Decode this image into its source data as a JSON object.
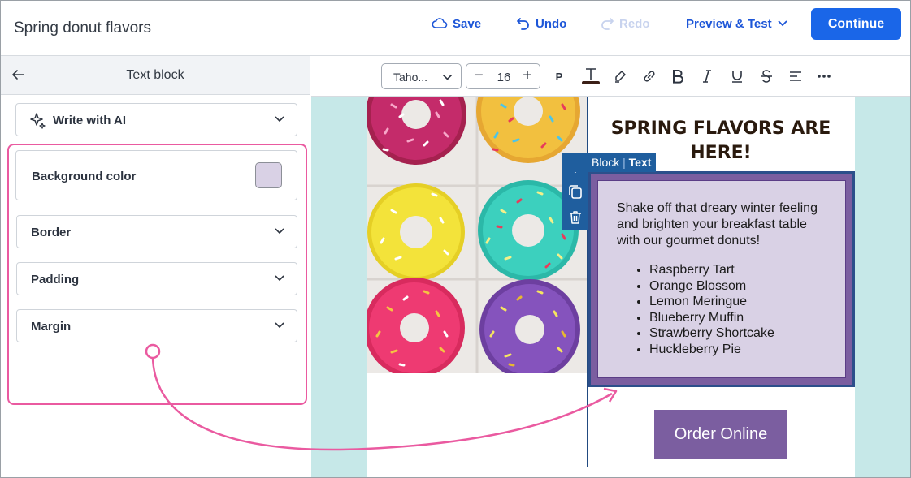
{
  "header": {
    "title": "Spring donut flavors",
    "save_label": "Save",
    "undo_label": "Undo",
    "redo_label": "Redo",
    "preview_label": "Preview & Test",
    "continue_label": "Continue"
  },
  "left_panel": {
    "title": "Text block",
    "ai_label": "Write with AI",
    "background_label": "Background color",
    "background_value": "#d9d1e5",
    "sections": [
      "Border",
      "Padding",
      "Margin"
    ]
  },
  "toolbar": {
    "font": "Taho...",
    "font_size": "16",
    "paragraph": "P"
  },
  "email": {
    "headline": "SPRING FLAVORS ARE HERE!",
    "block_tag_block": "Block",
    "block_tag_sep": "|",
    "block_tag_type": "Text",
    "paragraph": "Shake off that dreary winter feeling and brighten your breakfast table with our gourmet donuts!",
    "flavors": [
      "Raspberry Tart",
      "Orange Blossom",
      "Lemon Meringue",
      "Blueberry Muffin",
      "Strawberry Shortcake",
      "Huckleberry Pie"
    ],
    "button_label": "Order Online"
  },
  "colors": {
    "accent": "#1a66e8",
    "highlight": "#ea5aa0",
    "block_purple": "#7b5ea0",
    "canvas_bg": "#c6e8e8"
  }
}
